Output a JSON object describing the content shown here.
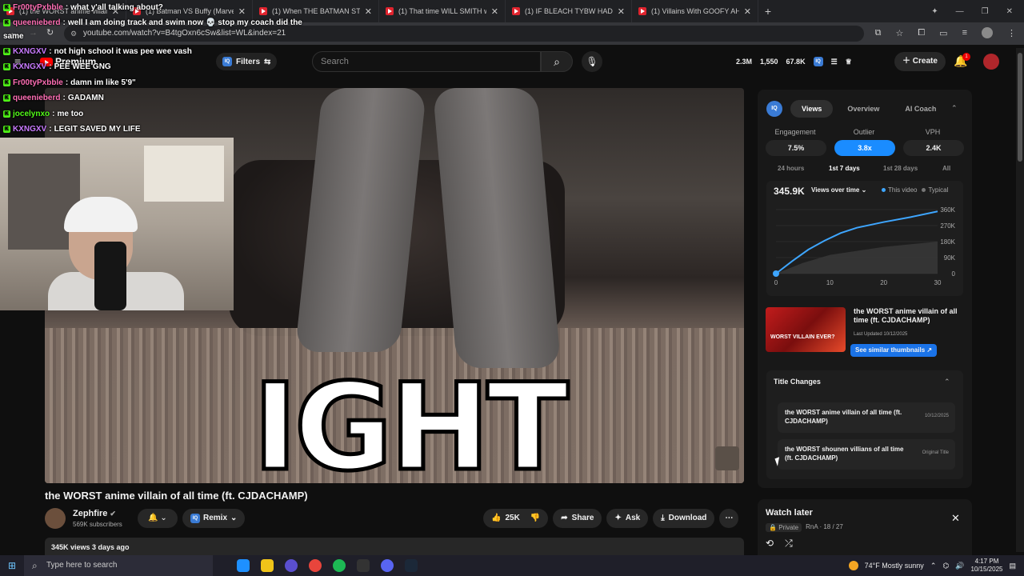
{
  "browser": {
    "tabs": [
      {
        "label": "(1) the WORST anime villain of all time"
      },
      {
        "label": "(1) Batman VS Buffy (Marvel VS"
      },
      {
        "label": "(1) When THE BATMAN STOPPED"
      },
      {
        "label": "(1) That time WILL SMITH was"
      },
      {
        "label": "(1) IF BLEACH TYBW HAD TOXIC"
      },
      {
        "label": "(1) Villains With GOOFY AH Po"
      }
    ],
    "url": "youtube.com/watch?v=B4tgOxn6cSw&list=WL&index=21"
  },
  "youtube": {
    "logo_text": "Premium",
    "filters_label": "Filters",
    "search_placeholder": "Search",
    "stats": {
      "views": "2.3M",
      "subs": "1,550",
      "videos": "67.8K"
    },
    "create_label": "Create",
    "notif_count": "1"
  },
  "chat": [
    {
      "user": "Fr00tyPxbble",
      "msg": "what y'all talking about?",
      "color": "#ff6fb5"
    },
    {
      "user": "queenieberd",
      "msg": "well I am doing track and swim now 💀 stop my coach did the",
      "color": "#ff6fb5"
    },
    {
      "user": "",
      "msg": "same",
      "color": "#ffffff"
    },
    {
      "user": "KXNGXV",
      "msg": "not high school it was pee wee vash",
      "color": "#c97bff"
    },
    {
      "user": "KXNGXV",
      "msg": "PEE WEE GNG",
      "color": "#c97bff"
    },
    {
      "user": "Fr00tyPxbble",
      "msg": "damn im like 5'9\"",
      "color": "#ff6fb5"
    },
    {
      "user": "queenieberd",
      "msg": "GADAMN",
      "color": "#ff6fb5"
    },
    {
      "user": "jocelynxo",
      "msg": "me too",
      "color": "#53fc18"
    },
    {
      "user": "KXNGXV",
      "msg": "LEGIT SAVED MY LIFE",
      "color": "#c97bff"
    }
  ],
  "video": {
    "overlay_text": "IGHT",
    "title": "the WORST anime villain of all time (ft. CJDACHAMP)",
    "channel": "Zephfire",
    "subscribers": "569K subscribers",
    "remix_label": "Remix",
    "likes": "25K",
    "share_label": "Share",
    "ask_label": "Ask",
    "download_label": "Download",
    "views_line": "345K views  3 days ago"
  },
  "panel": {
    "tabs": [
      "Views",
      "Overview",
      "AI Coach"
    ],
    "active_tab": "Views",
    "metrics": [
      {
        "label": "Engagement",
        "value": "7.5%"
      },
      {
        "label": "Outlier",
        "value": "3.8x"
      },
      {
        "label": "VPH",
        "value": "2.4K"
      }
    ],
    "ranges": [
      "24 hours",
      "1st 7 days",
      "1st 28 days",
      "All"
    ],
    "active_range": "1st 7 days",
    "views_total": "345.9K",
    "views_dropdown": "Views over time",
    "legend_this": "This video",
    "legend_typical": "Typical",
    "thumb_title": "the WORST anime villain of all time (ft. CJDACHAMP)",
    "thumb_updated": "Last Updated 10/12/2025",
    "thumb_overlay": "WORST VILLAIN EVER?",
    "similar_btn": "See similar thumbnails ↗",
    "title_changes_head": "Title Changes",
    "title_changes": [
      {
        "title": "the WORST anime villain of all time (ft. CJDACHAMP)",
        "date": "10/12/2025"
      },
      {
        "title": "the WORST shounen villians of all time (ft. CJDACHAMP)",
        "date": "Original Title"
      }
    ]
  },
  "chart_data": {
    "type": "line",
    "x": [
      0,
      1,
      2,
      3,
      4,
      5,
      6,
      7
    ],
    "xticks": [
      "0",
      "10",
      "20",
      "30"
    ],
    "yticks": [
      "0",
      "90K",
      "180K",
      "270K",
      "360K"
    ],
    "ylim": [
      0,
      360000
    ],
    "xlim": [
      0,
      30
    ],
    "series": [
      {
        "name": "This video",
        "color": "#3ea6ff",
        "points": [
          [
            0,
            0
          ],
          [
            3,
            70000
          ],
          [
            6,
            135000
          ],
          [
            9,
            185000
          ],
          [
            12,
            228000
          ],
          [
            15,
            258000
          ],
          [
            20,
            290000
          ],
          [
            25,
            318000
          ],
          [
            30,
            350000
          ]
        ]
      },
      {
        "name": "Typical",
        "color": "#777777",
        "points": [
          [
            0,
            0
          ],
          [
            5,
            60000
          ],
          [
            10,
            105000
          ],
          [
            20,
            150000
          ],
          [
            30,
            180000
          ]
        ]
      }
    ]
  },
  "watch_later": {
    "title": "Watch later",
    "privacy": "Private",
    "meta": "RnA · 18 / 27"
  },
  "taskbar": {
    "search_placeholder": "Type here to search",
    "weather": "74°F  Mostly sunny",
    "time": "4:17 PM",
    "date": "10/15/2025"
  }
}
